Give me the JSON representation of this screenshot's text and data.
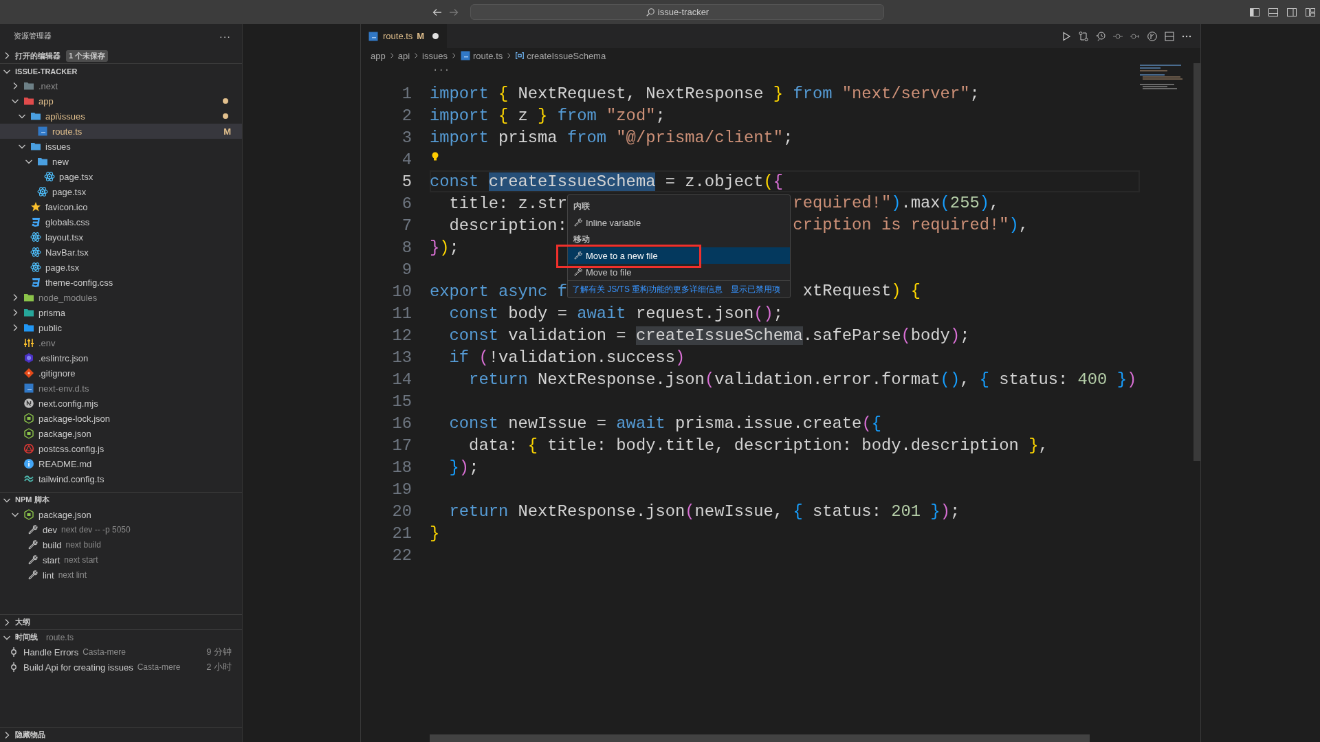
{
  "title_bar": {
    "search": "issue-tracker"
  },
  "sidebar": {
    "title": "资源管理器",
    "more": "···",
    "open_editors": {
      "label": "打开的编辑器",
      "badge": "1 个未保存",
      "expanded": false
    },
    "project": {
      "label": "ISSUE-TRACKER",
      "expanded": true,
      "items": [
        {
          "label": ".next",
          "kind": "folder-next",
          "expanded": false,
          "modified": false,
          "ignored": true,
          "selected": false
        },
        {
          "label": "app",
          "kind": "folder-app",
          "expanded": true,
          "modified": true,
          "ignored": false,
          "selected": false,
          "children": [
            {
              "label": "api\\issues",
              "kind": "folder",
              "expanded": true,
              "modified": true,
              "ignored": false,
              "selected": false,
              "children": [
                {
                  "label": "route.ts",
                  "kind": "ts",
                  "modified": true,
                  "ignored": false,
                  "decoration": "M",
                  "selected": true
                }
              ]
            },
            {
              "label": "issues",
              "kind": "folder",
              "expanded": true,
              "modified": false,
              "ignored": false,
              "selected": false,
              "children": [
                {
                  "label": "new",
                  "kind": "folder",
                  "expanded": true,
                  "modified": false,
                  "ignored": false,
                  "selected": false,
                  "children": [
                    {
                      "label": "page.tsx",
                      "kind": "react",
                      "modified": false,
                      "ignored": false,
                      "selected": false
                    }
                  ]
                },
                {
                  "label": "page.tsx",
                  "kind": "react",
                  "modified": false,
                  "ignored": false,
                  "selected": false
                }
              ]
            },
            {
              "label": "favicon.ico",
              "kind": "favicon",
              "modified": false,
              "ignored": false,
              "selected": false
            },
            {
              "label": "globals.css",
              "kind": "css",
              "modified": false,
              "ignored": false,
              "selected": false
            },
            {
              "label": "layout.tsx",
              "kind": "react",
              "modified": false,
              "ignored": false,
              "selected": false
            },
            {
              "label": "NavBar.tsx",
              "kind": "react",
              "modified": false,
              "ignored": false,
              "selected": false
            },
            {
              "label": "page.tsx",
              "kind": "react",
              "modified": false,
              "ignored": false,
              "selected": false
            },
            {
              "label": "theme-config.css",
              "kind": "css",
              "modified": false,
              "ignored": false,
              "selected": false
            }
          ]
        },
        {
          "label": "node_modules",
          "kind": "folder-node",
          "expanded": false,
          "modified": false,
          "ignored": true,
          "selected": false
        },
        {
          "label": "prisma",
          "kind": "folder-prisma",
          "expanded": false,
          "modified": false,
          "ignored": false,
          "selected": false
        },
        {
          "label": "public",
          "kind": "folder-public",
          "expanded": false,
          "modified": false,
          "ignored": false,
          "selected": false
        },
        {
          "label": ".env",
          "kind": "env",
          "modified": false,
          "ignored": true,
          "selected": false
        },
        {
          "label": ".eslintrc.json",
          "kind": "eslint",
          "modified": false,
          "ignored": false,
          "selected": false
        },
        {
          "label": ".gitignore",
          "kind": "git",
          "modified": false,
          "ignored": false,
          "selected": false
        },
        {
          "label": "next-env.d.ts",
          "kind": "ts",
          "modified": false,
          "ignored": true,
          "selected": false
        },
        {
          "label": "next.config.mjs",
          "kind": "next",
          "modified": false,
          "ignored": false,
          "selected": false
        },
        {
          "label": "package-lock.json",
          "kind": "node",
          "modified": false,
          "ignored": false,
          "selected": false
        },
        {
          "label": "package.json",
          "kind": "node",
          "modified": false,
          "ignored": false,
          "selected": false
        },
        {
          "label": "postcss.config.js",
          "kind": "postcss",
          "modified": false,
          "ignored": false,
          "selected": false
        },
        {
          "label": "README.md",
          "kind": "info",
          "modified": false,
          "ignored": false,
          "selected": false
        },
        {
          "label": "tailwind.config.ts",
          "kind": "tailwind",
          "modified": false,
          "ignored": false,
          "selected": false
        }
      ]
    },
    "npm_scripts": {
      "label": "NPM 脚本",
      "expanded": true,
      "file": {
        "label": "package.json",
        "expanded": true
      },
      "scripts": [
        {
          "name": "dev",
          "command": "next dev -- -p 5050"
        },
        {
          "name": "build",
          "command": "next build"
        },
        {
          "name": "start",
          "command": "next start"
        },
        {
          "name": "lint",
          "command": "next lint"
        }
      ]
    },
    "outline": {
      "label": "大纲",
      "expanded": false
    },
    "timeline": {
      "label": "时间线",
      "file": "route.ts",
      "expanded": true,
      "entries": [
        {
          "label": "Handle Errors",
          "author": "Casta-mere",
          "time": "9 分钟"
        },
        {
          "label": "Build Api for creating issues",
          "author": "Casta-mere",
          "time": "2 小时"
        }
      ]
    },
    "hidden": {
      "label": "隐藏物品",
      "expanded": false
    }
  },
  "editor": {
    "tabs": [
      {
        "label": "route.ts",
        "decoration": "M",
        "unsaved": true,
        "selected": true
      }
    ],
    "breadcrumb": [
      {
        "label": "app",
        "kind": "folder"
      },
      {
        "label": "api",
        "kind": "folder"
      },
      {
        "label": "issues",
        "kind": "folder"
      },
      {
        "label": "route.ts",
        "kind": "ts"
      },
      {
        "label": "createIssueSchema",
        "kind": "symbol"
      }
    ],
    "overflow_marker": "···",
    "lines": [
      {
        "number": "1",
        "active": false,
        "lightbulb": false,
        "tokens": [
          {
            "kind": "kw",
            "text": "import "
          },
          {
            "kind": "b1",
            "text": "{"
          },
          {
            "kind": "plain",
            "text": " NextRequest, NextResponse "
          },
          {
            "kind": "b1",
            "text": "}"
          },
          {
            "kind": "kw",
            "text": " from "
          },
          {
            "kind": "str",
            "text": "\"next/server\""
          },
          {
            "kind": "plain",
            "text": ";"
          }
        ]
      },
      {
        "number": "2",
        "active": false,
        "lightbulb": false,
        "tokens": [
          {
            "kind": "kw",
            "text": "import "
          },
          {
            "kind": "b1",
            "text": "{"
          },
          {
            "kind": "plain",
            "text": " z "
          },
          {
            "kind": "b1",
            "text": "}"
          },
          {
            "kind": "kw",
            "text": " from "
          },
          {
            "kind": "str",
            "text": "\"zod\""
          },
          {
            "kind": "plain",
            "text": ";"
          }
        ]
      },
      {
        "number": "3",
        "active": false,
        "lightbulb": false,
        "tokens": [
          {
            "kind": "kw",
            "text": "import "
          },
          {
            "kind": "plain",
            "text": "prisma "
          },
          {
            "kind": "kw",
            "text": "from "
          },
          {
            "kind": "str",
            "text": "\"@/prisma/client\""
          },
          {
            "kind": "plain",
            "text": ";"
          }
        ]
      },
      {
        "number": "4",
        "active": false,
        "lightbulb": true
      },
      {
        "number": "5",
        "active": true,
        "lightbulb": false,
        "tokens": [
          {
            "kind": "kw",
            "text": "const "
          },
          {
            "kind": "selection",
            "text": "createIssueSchema"
          },
          {
            "kind": "plain",
            "text": " = z.object"
          },
          {
            "kind": "b1",
            "text": "("
          },
          {
            "kind": "b2",
            "text": "{"
          }
        ]
      },
      {
        "number": "6",
        "active": false,
        "lightbulb": false,
        "tokens": [
          {
            "kind": "plain",
            "text": "  title: z.str"
          }
        ],
        "tokens_after_menu": [
          {
            "kind": "str",
            "text": "required!\""
          },
          {
            "kind": "b3",
            "text": ")"
          },
          {
            "kind": "plain",
            "text": ".max"
          },
          {
            "kind": "b3",
            "text": "("
          },
          {
            "kind": "num",
            "text": "255"
          },
          {
            "kind": "b3",
            "text": ")"
          },
          {
            "kind": "plain",
            "text": ","
          }
        ]
      },
      {
        "number": "7",
        "active": false,
        "lightbulb": false,
        "tokens": [
          {
            "kind": "plain",
            "text": "  description:"
          }
        ],
        "tokens_after_menu": [
          {
            "kind": "str",
            "text": "cription is required!\""
          },
          {
            "kind": "b3",
            "text": ")"
          },
          {
            "kind": "plain",
            "text": ","
          }
        ]
      },
      {
        "number": "8",
        "active": false,
        "lightbulb": false,
        "tokens": [
          {
            "kind": "b2",
            "text": "}"
          },
          {
            "kind": "b1",
            "text": ")"
          },
          {
            "kind": "plain",
            "text": ";"
          }
        ]
      },
      {
        "number": "9",
        "active": false,
        "lightbulb": false
      },
      {
        "number": "10",
        "active": false,
        "lightbulb": false,
        "tokens": [
          {
            "kind": "kw",
            "text": "export async f"
          }
        ],
        "tokens_after_menu": [
          {
            "kind": "plain",
            "text": " xtRequest"
          },
          {
            "kind": "b1",
            "text": ")"
          },
          {
            "kind": "b1",
            "text": " {"
          }
        ]
      },
      {
        "number": "11",
        "active": false,
        "lightbulb": false,
        "tokens": [
          {
            "kind": "kw",
            "text": "  const "
          },
          {
            "kind": "plain",
            "text": "body = "
          },
          {
            "kind": "kw",
            "text": "await "
          },
          {
            "kind": "plain",
            "text": "request.json"
          },
          {
            "kind": "b2",
            "text": "()"
          },
          {
            "kind": "plain",
            "text": ";"
          }
        ]
      },
      {
        "number": "12",
        "active": false,
        "lightbulb": false,
        "tokens": [
          {
            "kind": "kw",
            "text": "  const "
          },
          {
            "kind": "plain",
            "text": "validation = "
          },
          {
            "kind": "occurrence",
            "text": "createIssueSchema"
          },
          {
            "kind": "plain",
            "text": ".safeParse"
          },
          {
            "kind": "b2",
            "text": "("
          },
          {
            "kind": "plain",
            "text": "body"
          },
          {
            "kind": "b2",
            "text": ")"
          },
          {
            "kind": "plain",
            "text": ";"
          }
        ]
      },
      {
        "number": "13",
        "active": false,
        "lightbulb": false,
        "tokens": [
          {
            "kind": "kw",
            "text": "  if "
          },
          {
            "kind": "b2",
            "text": "("
          },
          {
            "kind": "plain",
            "text": "!validation.success"
          },
          {
            "kind": "b2",
            "text": ")"
          }
        ]
      },
      {
        "number": "14",
        "active": false,
        "lightbulb": false,
        "tokens": [
          {
            "kind": "kw",
            "text": "    return "
          },
          {
            "kind": "plain",
            "text": "NextResponse.json"
          },
          {
            "kind": "b2",
            "text": "("
          },
          {
            "kind": "plain",
            "text": "validation.error.format"
          },
          {
            "kind": "b3",
            "text": "()"
          },
          {
            "kind": "plain",
            "text": ", "
          },
          {
            "kind": "b3",
            "text": "{"
          },
          {
            "kind": "plain",
            "text": " status: "
          },
          {
            "kind": "num",
            "text": "400"
          },
          {
            "kind": "b3",
            "text": " }"
          },
          {
            "kind": "b2",
            "text": ")"
          }
        ]
      },
      {
        "number": "15",
        "active": false,
        "lightbulb": false
      },
      {
        "number": "16",
        "active": false,
        "lightbulb": false,
        "tokens": [
          {
            "kind": "kw",
            "text": "  const "
          },
          {
            "kind": "plain",
            "text": "newIssue = "
          },
          {
            "kind": "kw",
            "text": "await "
          },
          {
            "kind": "plain",
            "text": "prisma.issue.create"
          },
          {
            "kind": "b2",
            "text": "("
          },
          {
            "kind": "b3",
            "text": "{"
          }
        ]
      },
      {
        "number": "17",
        "active": false,
        "lightbulb": false,
        "tokens": [
          {
            "kind": "plain",
            "text": "    data: "
          },
          {
            "kind": "b1",
            "text": "{"
          },
          {
            "kind": "plain",
            "text": " title: body.title, description: body.description "
          },
          {
            "kind": "b1",
            "text": "}"
          },
          {
            "kind": "plain",
            "text": ","
          }
        ]
      },
      {
        "number": "18",
        "active": false,
        "lightbulb": false,
        "tokens": [
          {
            "kind": "b3",
            "text": "  }"
          },
          {
            "kind": "b2",
            "text": ")"
          },
          {
            "kind": "plain",
            "text": ";"
          }
        ]
      },
      {
        "number": "19",
        "active": false,
        "lightbulb": false
      },
      {
        "number": "20",
        "active": false,
        "lightbulb": false,
        "tokens": [
          {
            "kind": "kw",
            "text": "  return "
          },
          {
            "kind": "plain",
            "text": "NextResponse.json"
          },
          {
            "kind": "b2",
            "text": "("
          },
          {
            "kind": "plain",
            "text": "newIssue, "
          },
          {
            "kind": "b3",
            "text": "{"
          },
          {
            "kind": "plain",
            "text": " status: "
          },
          {
            "kind": "num",
            "text": "201"
          },
          {
            "kind": "b3",
            "text": " }"
          },
          {
            "kind": "b2",
            "text": ")"
          },
          {
            "kind": "plain",
            "text": ";"
          }
        ]
      },
      {
        "number": "21",
        "active": false,
        "lightbulb": false,
        "tokens": [
          {
            "kind": "b1",
            "text": "}"
          }
        ]
      },
      {
        "number": "22",
        "active": false,
        "lightbulb": false
      }
    ],
    "menu": {
      "items": [
        {
          "kind": "header",
          "label": "内联"
        },
        {
          "kind": "action",
          "label": "Inline variable",
          "selected": false,
          "annotated": false
        },
        {
          "kind": "header",
          "label": "移动"
        },
        {
          "kind": "action",
          "label": "Move to a new file",
          "selected": true,
          "annotated": true
        },
        {
          "kind": "action",
          "label": "Move to file",
          "selected": false,
          "annotated": false
        }
      ],
      "links": [
        "了解有关 JS/TS 重构功能的更多详细信息",
        "显示已禁用项"
      ]
    }
  }
}
